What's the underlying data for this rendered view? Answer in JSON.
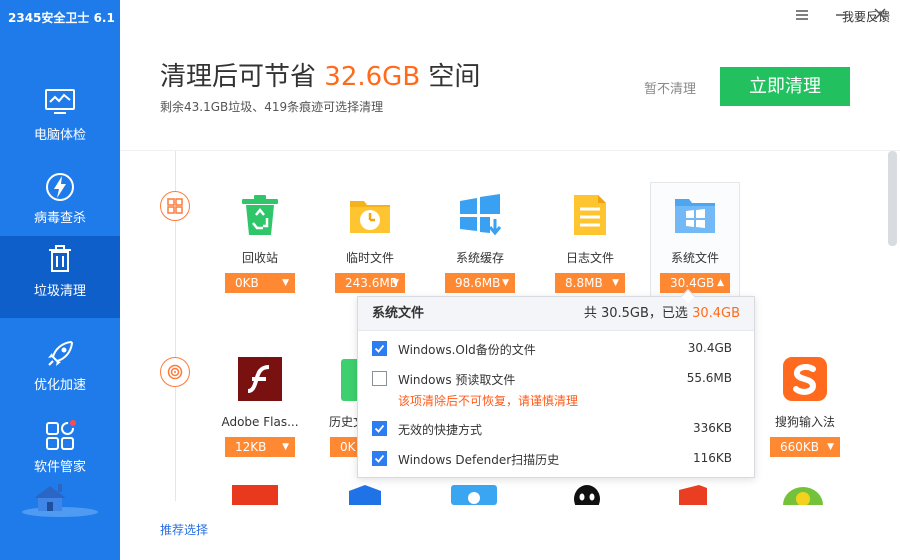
{
  "app": {
    "title": "2345安全卫士 6.1"
  },
  "window": {
    "feedback": "我要反馈"
  },
  "sidebar": {
    "items": [
      {
        "label": "电脑体检",
        "icon": "monitor-icon"
      },
      {
        "label": "病毒查杀",
        "icon": "lightning-shield-icon"
      },
      {
        "label": "垃圾清理",
        "icon": "trash-icon",
        "active": true
      },
      {
        "label": "优化加速",
        "icon": "rocket-icon"
      },
      {
        "label": "软件管家",
        "icon": "apps-icon"
      }
    ]
  },
  "header": {
    "title_prefix": "清理后可节省",
    "title_amount": "32.6GB",
    "title_suffix": "空间",
    "subtitle": "剩余43.1GB垃圾、419条痕迹可选择清理",
    "skip_label": "暂不清理",
    "clean_label": "立即清理"
  },
  "row1": [
    {
      "name": "回收站",
      "size": "0KB",
      "icon": "recycle-bin-icon"
    },
    {
      "name": "临时文件",
      "size": "243.6MB",
      "icon": "temp-folder-icon"
    },
    {
      "name": "系统缓存",
      "size": "98.6MB",
      "icon": "system-cache-icon"
    },
    {
      "name": "日志文件",
      "size": "8.8MB",
      "icon": "log-file-icon"
    },
    {
      "name": "系统文件",
      "size": "30.4GB",
      "icon": "system-files-icon"
    }
  ],
  "row2": [
    {
      "name": "Adobe Flas...",
      "size": "12KB",
      "icon": "flash-icon"
    },
    {
      "name": "历史文",
      "size": "0K",
      "icon": "history-icon"
    },
    {
      "name": "搜狗输入法",
      "size": "660KB",
      "icon": "sogou-icon"
    }
  ],
  "popup": {
    "title": "系统文件",
    "summary_prefix": "共 30.5GB，已选",
    "summary_selected": "30.4GB",
    "rows": [
      {
        "label": "Windows.Old备份的文件",
        "value": "30.4GB",
        "checked": true
      },
      {
        "label": "Windows 预读取文件",
        "value": "55.6MB",
        "checked": false
      },
      {
        "label": "无效的快捷方式",
        "value": "336KB",
        "checked": true
      },
      {
        "label": "Windows Defender扫描历史",
        "value": "116KB",
        "checked": true
      }
    ],
    "warning": "该项清除后不可恢复，请谨慎清理"
  },
  "footer": {
    "recommend": "推荐选择"
  },
  "colors": {
    "sidebar": "#1f7bea",
    "sidebar_active": "#0f5fcb",
    "accent": "#ff6b1a",
    "primary_button": "#22c05f",
    "size_badge": "#ff8833",
    "checkbox": "#2d7cf0"
  }
}
